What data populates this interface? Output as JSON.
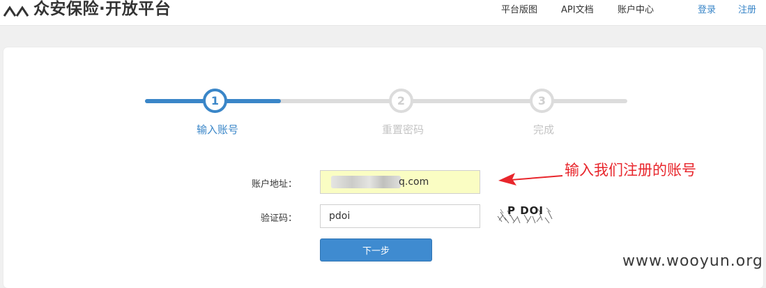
{
  "header": {
    "logo_text": "众安保险·开放平台",
    "nav": [
      "平台版图",
      "API文档",
      "账户中心"
    ],
    "login": "登录",
    "register": "注册"
  },
  "steps": [
    {
      "number": "1",
      "label": "输入账号",
      "state": "active"
    },
    {
      "number": "2",
      "label": "重置密码",
      "state": "inactive"
    },
    {
      "number": "3",
      "label": "完成",
      "state": "inactive"
    }
  ],
  "form": {
    "account_label": "账户地址：",
    "account_value_visible": "q.com",
    "captcha_label": "验证码：",
    "captcha_value": "pdoi",
    "captcha_image_text": "P DOI",
    "next_button": "下一步"
  },
  "annotation": {
    "text": "输入我们注册的账号",
    "color": "#e8262c"
  },
  "watermark": "www.wooyun.org",
  "colors": {
    "accent": "#3a86c8",
    "button": "#3f8bd0",
    "inactive_step": "#dcdcdc",
    "autofill_bg": "#fafdc3"
  }
}
